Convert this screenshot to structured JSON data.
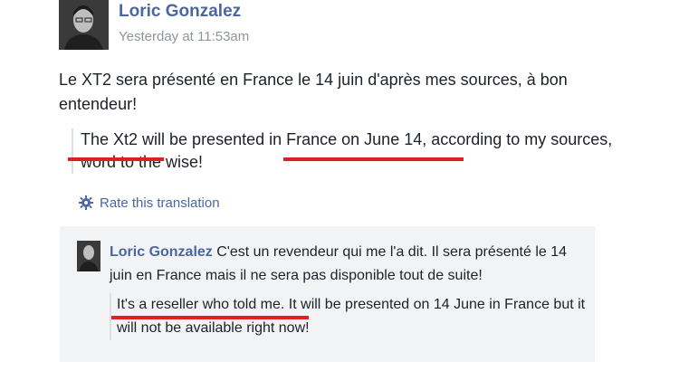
{
  "post": {
    "author": "Loric Gonzalez",
    "timestamp": "Yesterday at 11:53am",
    "text": "Le XT2 sera présenté en France le 14 juin d'après mes sources, à bon entendeur!",
    "translation": "The Xt2 will be presented in France on June 14, according to my sources, word to the wise!",
    "rate_label": "Rate this translation"
  },
  "comment": {
    "author": "Loric Gonzalez",
    "text": "C'est un revendeur qui me l'a dit. Il sera présenté le 14 juin en France mais il ne sera pas disponible tout de suite!",
    "translation": "It's a reseller who told me. It will be presented on 14 June in France but it will not be available right now!"
  },
  "colors": {
    "link": "#4b67a1",
    "highlight": "#e02020",
    "muted": "#90949c",
    "comment_bg": "#f2f3f5"
  }
}
